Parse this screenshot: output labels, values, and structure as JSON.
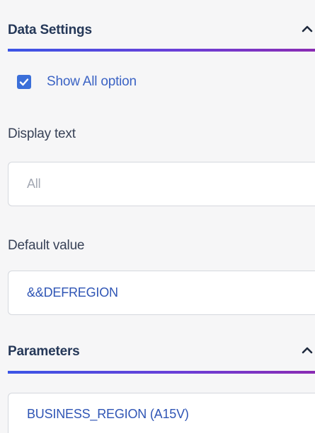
{
  "data_settings": {
    "title": "Data Settings",
    "collapse_icon": "chevron-up-icon",
    "show_all": {
      "label": "Show All option",
      "checked": true
    },
    "display_text": {
      "label": "Display text",
      "value": "",
      "placeholder": "All"
    },
    "default_value": {
      "label": "Default value",
      "value": "&&DEFREGION"
    }
  },
  "parameters": {
    "title": "Parameters",
    "collapse_icon": "chevron-up-icon",
    "items": [
      {
        "label": "BUSINESS_REGION (A15V)"
      }
    ]
  },
  "colors": {
    "accent_gradient_start": "#3b55e6",
    "accent_gradient_end": "#8a2bb3",
    "link_blue": "#2f55b5",
    "checkbox_blue": "#3b6fd9"
  }
}
